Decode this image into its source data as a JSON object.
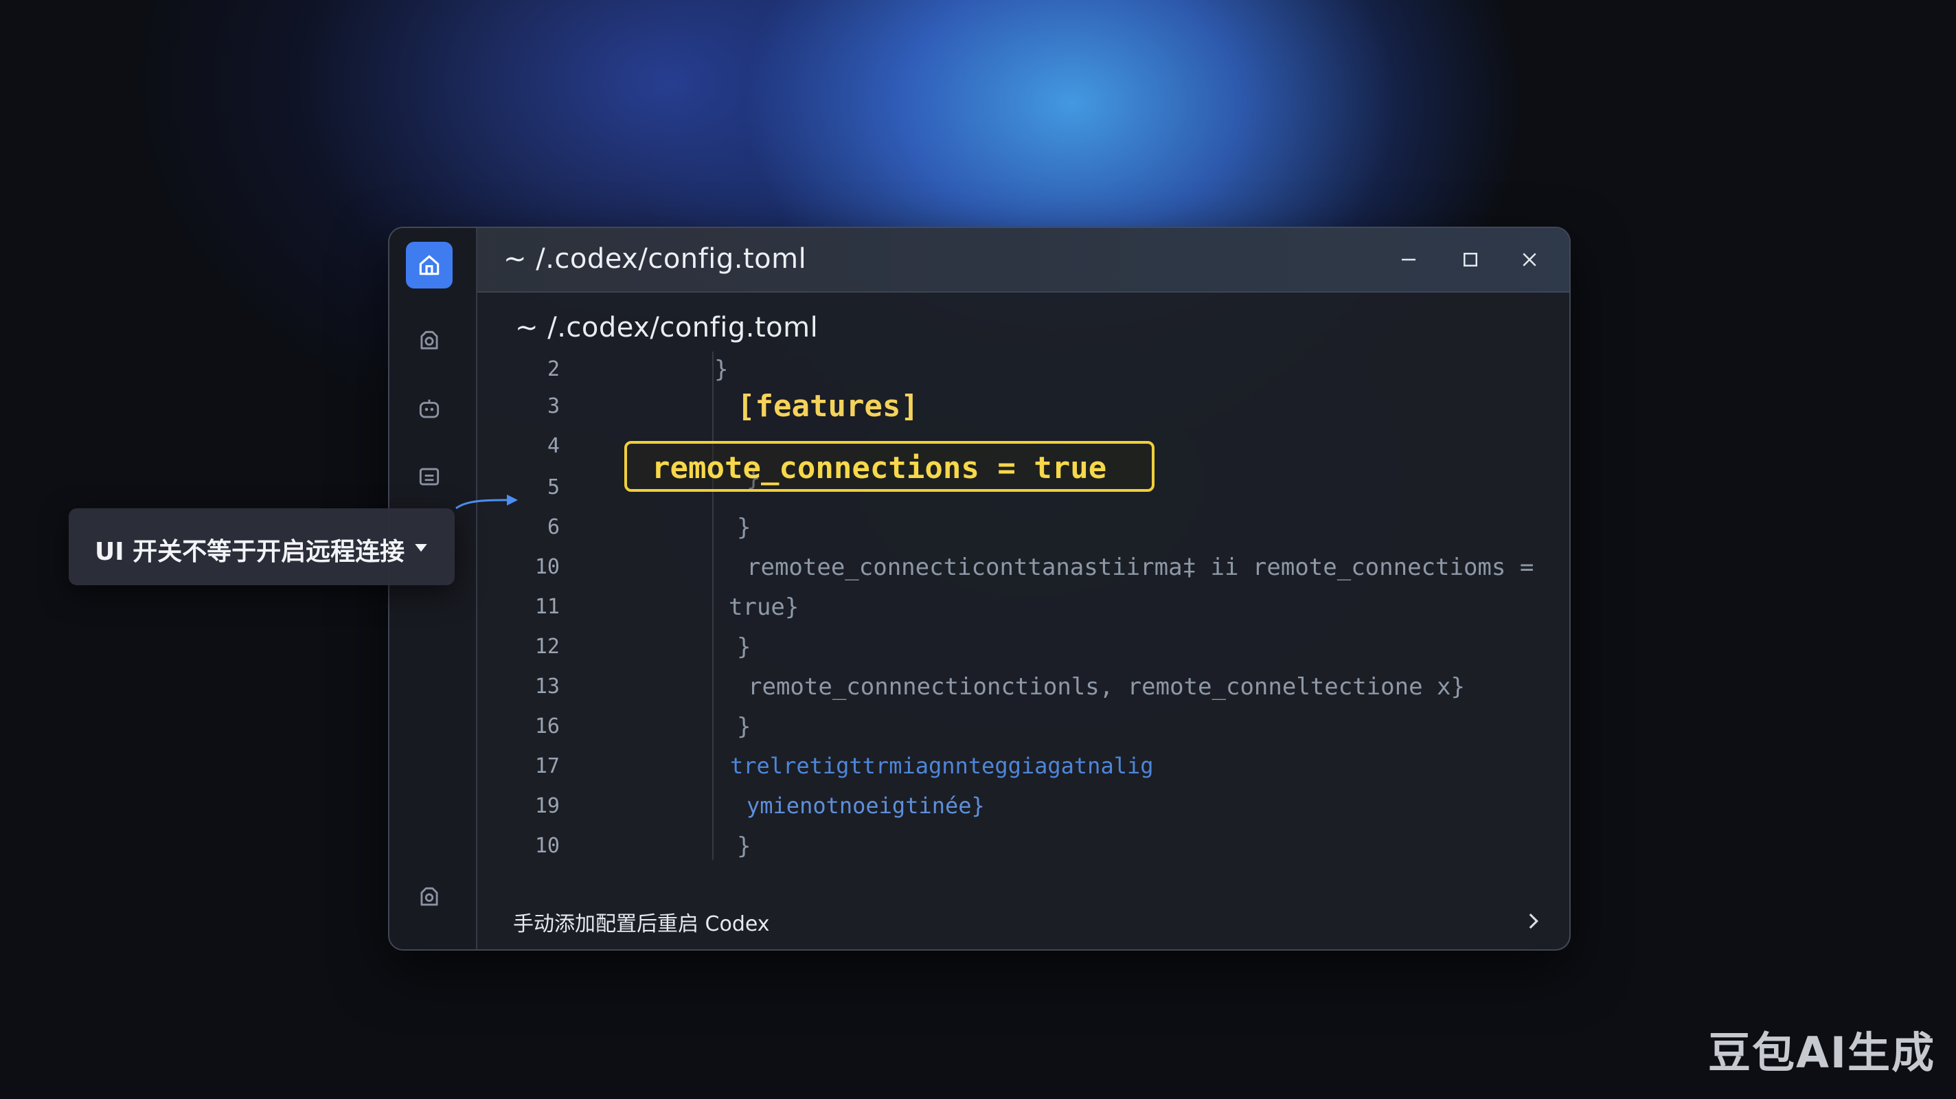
{
  "window": {
    "title": "~ /.codex/config.toml",
    "editor_header": "~ /.codex/config.toml",
    "footer_text": "手动添加配置后重启 Codex"
  },
  "sidebar": {
    "items": [
      {
        "icon": "home-icon",
        "active": true
      },
      {
        "icon": "gear-icon",
        "active": false
      },
      {
        "icon": "robot-icon",
        "active": false
      },
      {
        "icon": "document-icon",
        "active": false
      },
      {
        "icon": "settings-icon",
        "active": false
      }
    ]
  },
  "code_lines": [
    {
      "num": "2",
      "text": "}"
    },
    {
      "num": "3",
      "text": "[features]"
    },
    {
      "num": "4",
      "text": "remote_connections = true"
    },
    {
      "num": "5",
      "text": "}"
    },
    {
      "num": "6",
      "text": "}"
    },
    {
      "num": "10",
      "text": "remotee_connecticonttanastiirma‡ ii remote_connectioms ="
    },
    {
      "num": "11",
      "text": "true}"
    },
    {
      "num": "12",
      "text": "}"
    },
    {
      "num": "13",
      "text": "remote_connnectionctionls, remote_conneltectione x}"
    },
    {
      "num": "16",
      "text": "}"
    },
    {
      "num": "17",
      "text": "trelretigttrmiagnnteggiagatnalig"
    },
    {
      "num": "19",
      "text": "ymienotnoeigtinée}"
    },
    {
      "num": "10",
      "text": "}"
    }
  ],
  "callout": {
    "text": "UI 开关不等于开启远程连接"
  },
  "watermark": "豆包AI生成",
  "colors": {
    "accent": "#3f7cf0",
    "highlight": "#f0cf3a",
    "keyword_blue": "#4f86d9"
  }
}
